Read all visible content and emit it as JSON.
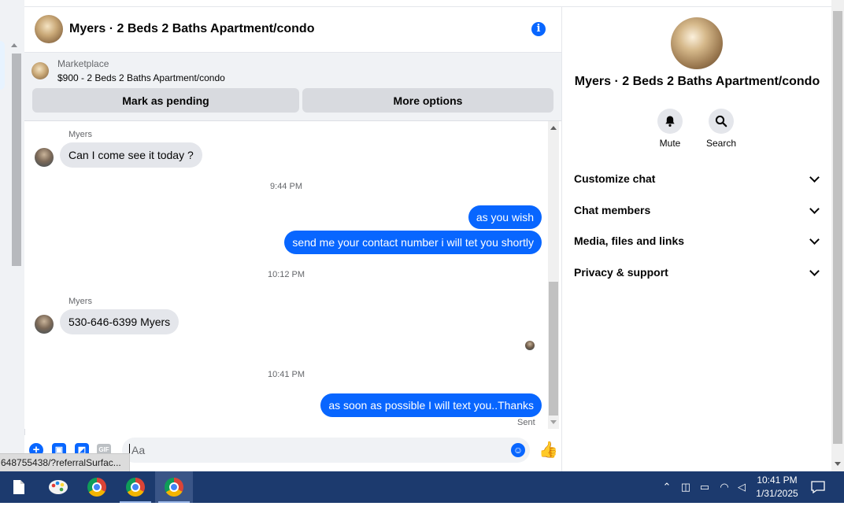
{
  "chat": {
    "title": "Myers · 2 Beds 2 Baths Apartment/condo",
    "info_icon": "info-icon"
  },
  "marketplace": {
    "label": "Marketplace",
    "listing": "$900 - 2 Beds 2 Baths Apartment/condo",
    "mark_pending_label": "Mark as pending",
    "more_options_label": "More options"
  },
  "messages": {
    "sender_1": "Myers",
    "msg_1": "Can I come see it today ?",
    "time_1": "9:44 PM",
    "out_1": "as you wish",
    "out_2": "send me your contact number i will tet you shortly",
    "time_2": "10:12 PM",
    "sender_2": "Myers",
    "msg_2": "530-646-6399 Myers",
    "time_3": "10:41 PM",
    "out_3": "as soon as possible I will text you..Thanks",
    "status": "Sent"
  },
  "composer": {
    "placeholder": "Aa",
    "value": "",
    "icons": [
      "plus-icon",
      "photo-icon",
      "sticker-icon",
      "gif-icon",
      "emoji-icon",
      "thumbs-up-icon"
    ],
    "gif_label": "GIF"
  },
  "status_url": "648755438/?referralSurfac...",
  "panel": {
    "title": "Myers · 2 Beds 2 Baths Apartment/condo",
    "mute_label": "Mute",
    "search_label": "Search",
    "sections": [
      "Customize chat",
      "Chat members",
      "Media, files and links",
      "Privacy & support"
    ]
  },
  "taskbar": {
    "apps": [
      "file-icon",
      "paint-icon",
      "chrome-icon",
      "chrome-profile-a-icon",
      "chrome-profile-icon"
    ],
    "time": "10:41 PM",
    "date": "1/31/2025"
  },
  "colors": {
    "accent": "#0866ff",
    "bubble_in": "#e4e6eb",
    "panel_bg": "#f0f2f5",
    "taskbar": "#1c3a6e"
  }
}
